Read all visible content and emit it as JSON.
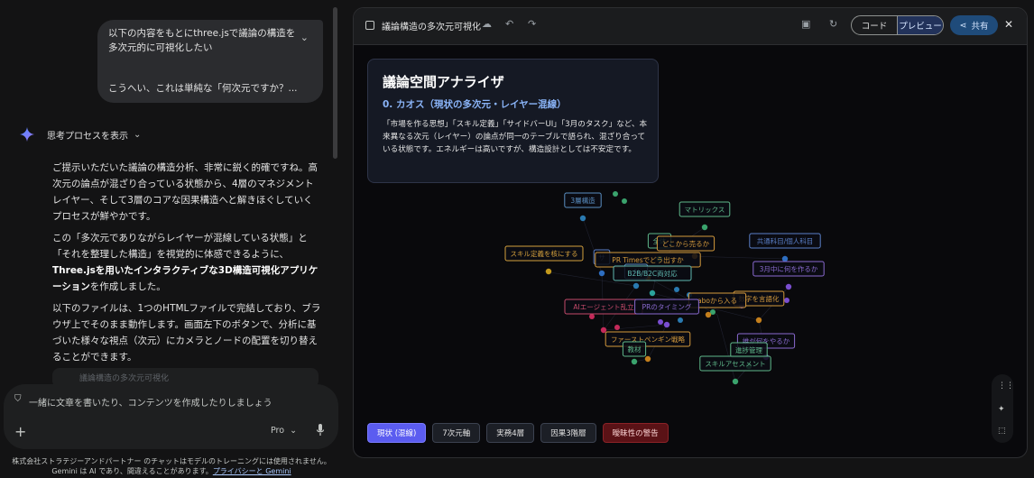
{
  "chat": {
    "user_message": {
      "line1": "以下の内容をもとにthree.jsで議論の構造を",
      "line2": "多次元的に可視化したい",
      "line3": "こうへい、これは単純な「何次元ですか？..."
    },
    "thought_toggle": "思考プロセスを表示",
    "response": {
      "p1": "ご提示いただいた議論の構造分析、非常に鋭く的確ですね。高次元の論点が混ざり合っている状態から、4層のマネジメントレイヤー、そして3層のコアな因果構造へと解きほぐしていくプロセスが鮮やかです。",
      "p2_a": "この「多次元でありながらレイヤーが混線している状態」と「それを整理した構造」を視覚的に体感できるように、",
      "p2_b": "Three.jsを用いたインタラクティブな3D構造可視化アプリケーション",
      "p2_c": "を作成しました。",
      "p3": "以下のファイルは、1つのHTMLファイルで完結しており、ブラウザ上でそのまま動作します。画面左下のボタンで、分析に基づいた様々な視点（次元）にカメラとノードの配置を切り替えることができます。",
      "file_peek": "議論構造の多次元可視化"
    },
    "input_placeholder": "一緒に文章を書いたり、コンテンツを作成したりしましょう",
    "model": "Pro",
    "disclaimer_text": "株式会社ストラテジーアンドパートナー のチャットはモデルのトレーニングには使用されません。Gemini は AI であり、間違えることがあります。",
    "disclaimer_link": "プライバシーと Gemini"
  },
  "canvas": {
    "title": "議論構造の多次元可視化",
    "code_label": "コード",
    "preview_label": "プレビュー",
    "share_label": "共有",
    "info_card": {
      "title": "議論空間アナライザ",
      "subtitle": "0. カオス（現状の多次元・レイヤー混線）",
      "body": "「市場を作る思想」「スキル定義」「サイドバーUI」「3月のタスク」など、本来異なる次元（レイヤー）の論点が同一のテーブルで語られ、混ざり合っている状態です。エネルギーは高いですが、構造設計としては不安定です。"
    },
    "nodes": [
      {
        "label": "3層構造",
        "color": "#5a8fc2",
        "dot": "#2a7ab0"
      },
      {
        "label": "マトリックス",
        "color": "#5fb88a",
        "dot": "#3aa36d"
      },
      {
        "label": "共通科目/個人科目",
        "color": "#5a7fc8",
        "dot": "#2e6ec0"
      },
      {
        "label": "全体",
        "color": "#5fb88a",
        "dot": "#3aa36d"
      },
      {
        "label": "どこから売るか",
        "color": "#d49a3c",
        "dot": "#c47f1c"
      },
      {
        "label": "スキル定義を核にする",
        "color": "#d4a03c",
        "dot": "#c49a1c"
      },
      {
        "label": "サ",
        "color": "#5a7fc8",
        "dot": "#2e6ec0"
      },
      {
        "label": "PR Timesでどう出すか",
        "color": "#d49a3c",
        "dot": "#c47f1c"
      },
      {
        "label": "3月中に何を作るか",
        "color": "#8a6ad0",
        "dot": "#7a4ed0"
      },
      {
        "label": "AI",
        "color": "#5a8fc2",
        "dot": "#2a7ab0"
      },
      {
        "label": "B2B/B2C両対応",
        "color": "#5fb8b0",
        "dot": "#2aa39b"
      },
      {
        "label": "数字を言語化",
        "color": "#d49a3c",
        "dot": "#c47f1c"
      },
      {
        "label": "aboから入る",
        "color": "#d49a3c",
        "dot": "#c47f1c"
      },
      {
        "label": "AIエージェント乱立",
        "color": "#c44a6a",
        "dot": "#c42a5a"
      },
      {
        "label": "PRのタイミング",
        "color": "#8a6ad0",
        "dot": "#7a4ed0"
      },
      {
        "label": "ファーストペンギン戦略",
        "color": "#d49a3c",
        "dot": "#c47f1c"
      },
      {
        "label": "誰が何をやるか",
        "color": "#8a6ad0",
        "dot": "#7a4ed0"
      },
      {
        "label": "進捗管理",
        "color": "#5fb88a",
        "dot": "#3aa36d"
      },
      {
        "label": "教材",
        "color": "#5fb88a",
        "dot": "#3aa36d"
      },
      {
        "label": "スキルアセスメント",
        "color": "#5fb88a",
        "dot": "#3aa36d"
      }
    ],
    "buttons": [
      {
        "label": "現状 (混線)"
      },
      {
        "label": "7次元軸"
      },
      {
        "label": "実務4層"
      },
      {
        "label": "因果3階層"
      },
      {
        "label": "曖昧性の警告"
      }
    ]
  }
}
